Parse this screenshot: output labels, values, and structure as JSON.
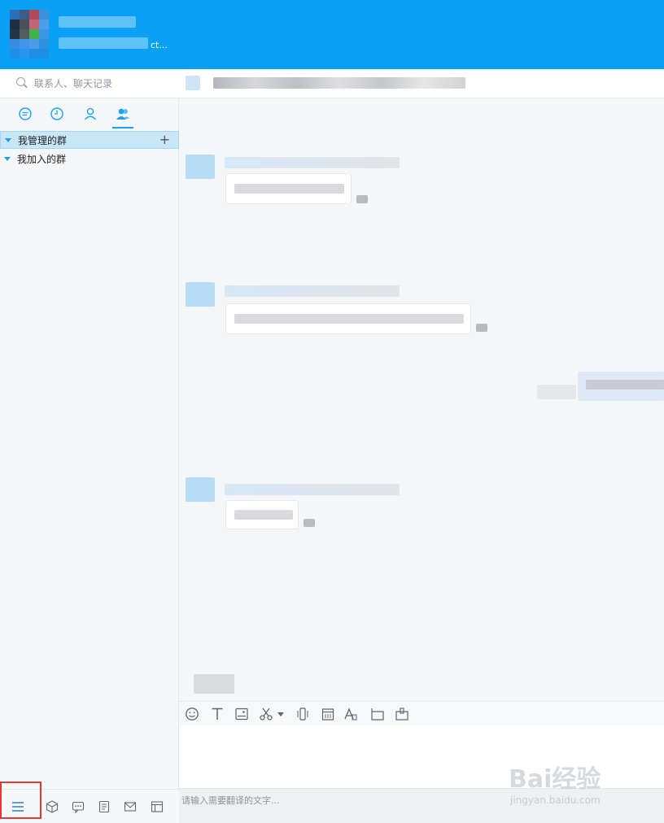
{
  "header": {
    "status_text": "ct..."
  },
  "search": {
    "placeholder": "联系人、聊天记录"
  },
  "tabs": [
    {
      "name": "chat",
      "icon": "chat-bubble-icon"
    },
    {
      "name": "recent",
      "icon": "clock-icon"
    },
    {
      "name": "contacts",
      "icon": "person-icon"
    },
    {
      "name": "groups",
      "icon": "group-icon",
      "active": true
    }
  ],
  "groups": {
    "managed": {
      "label": "我管理的群"
    },
    "joined": {
      "label": "我加入的群"
    }
  },
  "bottom_bar": {
    "icons": [
      "menu-icon",
      "cube-icon",
      "chat-window-icon",
      "notes-icon",
      "mail-icon",
      "layout-icon"
    ]
  },
  "toolbar": {
    "icons": [
      "emoji-icon",
      "text-format-icon",
      "image-icon",
      "scissors-icon",
      "shake-icon",
      "calendar-icon",
      "font-icon",
      "screenshot-icon",
      "file-icon"
    ]
  },
  "translate": {
    "placeholder": "请输入需要翻译的文字..."
  },
  "watermark": {
    "logo": "Bai经验",
    "url": "jingyan.baidu.com"
  },
  "colors": {
    "header": "#0aa1f5",
    "accent": "#1aa1f0",
    "selected_row": "#c8e8fa",
    "highlight_box": "#e53935"
  }
}
